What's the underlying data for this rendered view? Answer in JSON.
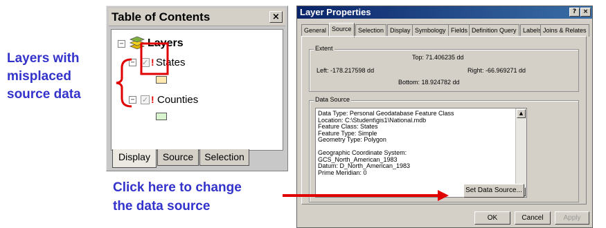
{
  "annotations": {
    "left_line1": "Layers with",
    "left_line2": "misplaced",
    "left_line3": "source data",
    "bottom_line1": "Click here to change",
    "bottom_line2": "the data source",
    "color": "#3333cc",
    "marker_color": "#e00000"
  },
  "toc": {
    "title": "Table of Contents",
    "close_symbol": "×",
    "root_label": "Layers",
    "layers": [
      {
        "name": "States",
        "swatch_color": "#ffe9b0",
        "warning": "!",
        "checked": true
      },
      {
        "name": "Counties",
        "swatch_color": "#d8f5d0",
        "warning": "!",
        "checked": true
      }
    ],
    "tabs": [
      {
        "label": "Display",
        "active": true
      },
      {
        "label": "Source",
        "active": false
      },
      {
        "label": "Selection",
        "active": false
      }
    ]
  },
  "layer_properties": {
    "title": "Layer Properties",
    "help_symbol": "?",
    "close_symbol": "×",
    "tabs": [
      "General",
      "Source",
      "Selection",
      "Display",
      "Symbology",
      "Fields",
      "Definition Query",
      "Labels",
      "Joins & Relates"
    ],
    "active_tab": "Source",
    "extent": {
      "label": "Extent",
      "top": "Top:   71.406235 dd",
      "left": "Left: -178.217598 dd",
      "right": "Right: -66.969271 dd",
      "bottom": "Bottom:  18.924782 dd"
    },
    "data_source": {
      "label": "Data Source",
      "lines": [
        "Data Type: Personal Geodatabase Feature Class",
        "Location: C:\\Student\\gis1\\National.mdb",
        "Feature Class: States",
        "Feature Type: Simple",
        "Geometry Type: Polygon",
        "",
        "Geographic Coordinate System:",
        "GCS_North_American_1983",
        "Datum: D_North_American_1983",
        "Prime Meridian: 0"
      ],
      "set_button": "Set Data Source..."
    },
    "buttons": {
      "ok": "OK",
      "cancel": "Cancel",
      "apply": "Apply"
    }
  }
}
